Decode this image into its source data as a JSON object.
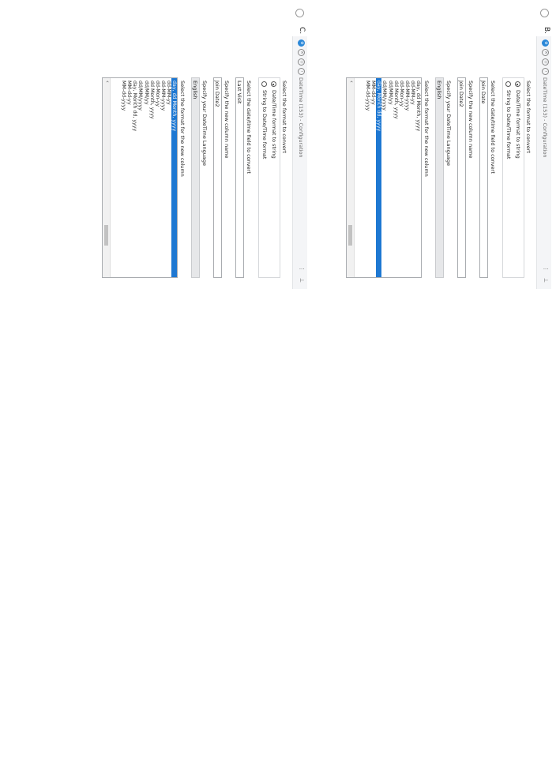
{
  "options": [
    {
      "letter": "B.",
      "panel": {
        "title": "DateTime (153) - Configuration",
        "menu_glyph": "⋮",
        "format_label": "Select the format to convert",
        "radio_1": "Date/Time format to string",
        "radio_2": "String to Date/Time format",
        "field_label": "Select the date/time field to convert",
        "field_value": "Join Date",
        "newcol_label": "Specify the new column name",
        "newcol_value": "Join Date2",
        "lang_label": "Specify your DateTime Language",
        "lang_value": "English",
        "list_label": "Select the format for the new column",
        "list_items": [
          "day, dd Month, yyyy",
          "dd-MM-yy",
          "dd-MM-yyyy",
          "dd-Mon-yy",
          "dd Month, yyyy",
          "dd/MM/yy",
          "dd/MM/yyyy",
          "day, Month dd, yyyy",
          "MM-dd-yy",
          "MM-dd-yyyy"
        ],
        "selected_index": 7,
        "scroll_left": "‹"
      }
    },
    {
      "letter": "C.",
      "panel": {
        "title": "DateTime (153) - Configuration",
        "menu_glyph": "⋮",
        "format_label": "Select the format to convert",
        "radio_1": "Date/Time format to string",
        "radio_2": "String to Date/Time format",
        "field_label": "Select the date/time field to convert",
        "field_value": "Last Visit",
        "newcol_label": "Specify the new column name",
        "newcol_value": "Join Date2",
        "lang_label": "Specify your DateTime Language",
        "lang_value": "English",
        "list_label": "Select the format for the new column",
        "list_items": [
          "day, dd Month, yyyy",
          "dd-MM-yy",
          "dd-MM-yyyy",
          "dd-Mon-yy",
          "dd Month, yyyy",
          "dd/MM/yy",
          "dd/MM/yyyy",
          "day, Month dd, yyyy",
          "MM-dd-yy",
          "MM-dd-yyyy"
        ],
        "selected_index": 0,
        "scroll_left": "‹"
      }
    }
  ]
}
